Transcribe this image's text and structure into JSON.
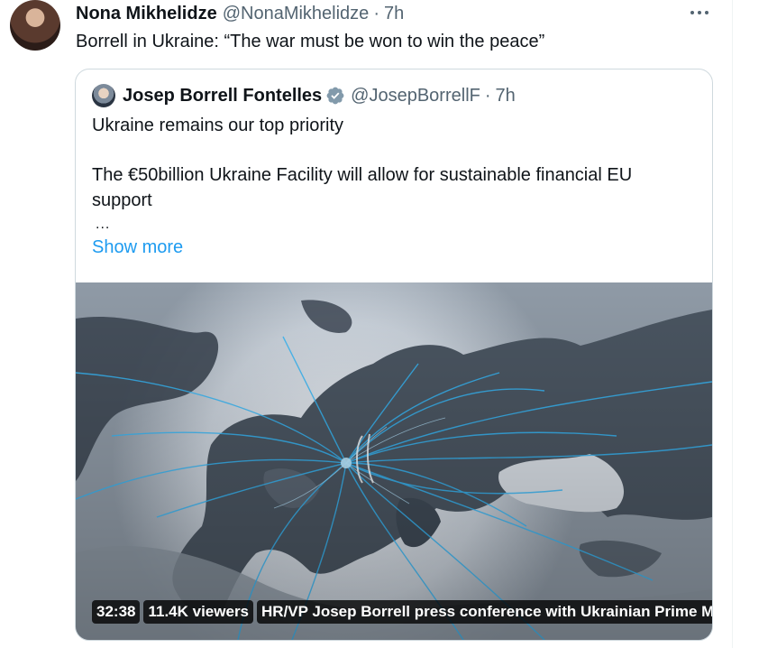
{
  "tweet": {
    "author_name": "Nona Mikhelidze",
    "author_handle": "@NonaMikhelidze",
    "separator": "·",
    "time": "7h",
    "text": "Borrell in Ukraine: “The war must be won to win the peace”"
  },
  "quote": {
    "author_name": "Josep Borrell Fontelles",
    "author_handle": "@JosepBorrellF",
    "separator": "·",
    "time": "7h",
    "line1": "Ukraine remains our top priority",
    "line2": "The €50billion Ukraine Facility will allow for sustainable financial EU",
    "line3": "support",
    "ellipsis": "...",
    "show_more": "Show more",
    "media": {
      "duration": "32:38",
      "viewers": "11.4K viewers",
      "title": "HR/VP Josep Borrell press conference with Ukrainian Prime M"
    }
  },
  "colors": {
    "link": "#1d9bf0",
    "secondary_text": "#536471",
    "verified": "#829aab",
    "border": "#cfd9de"
  },
  "icons": {
    "more": "more-horizontal-icon",
    "verified": "verified-badge-icon"
  }
}
